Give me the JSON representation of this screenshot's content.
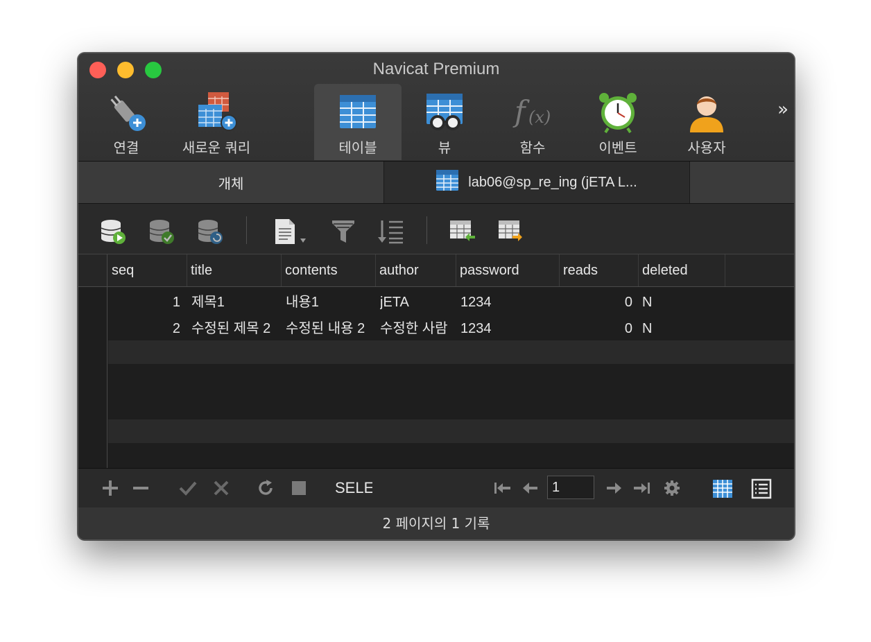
{
  "window": {
    "title": "Navicat Premium"
  },
  "toolbar": {
    "items": [
      {
        "label": "연결",
        "icon": "plug-add-icon"
      },
      {
        "label": "새로운 쿼리",
        "icon": "new-query-icon"
      },
      {
        "label": "테이블",
        "icon": "table-icon",
        "active": true
      },
      {
        "label": "뷰",
        "icon": "view-icon"
      },
      {
        "label": "함수",
        "icon": "function-icon"
      },
      {
        "label": "이벤트",
        "icon": "alarm-clock-icon"
      },
      {
        "label": "사용자",
        "icon": "user-icon"
      }
    ],
    "more": "»"
  },
  "tabs": {
    "objects": "개체",
    "table": "lab06@sp_re_ing (jETA L..."
  },
  "grid": {
    "columns": [
      "seq",
      "title",
      "contents",
      "author",
      "password",
      "reads",
      "deleted"
    ],
    "rows": [
      {
        "seq": "1",
        "title": "제목1",
        "contents": "내용1",
        "author": "jETA",
        "password": "1234",
        "reads": "0",
        "deleted": "N"
      },
      {
        "seq": "2",
        "title": "수정된 제목 2",
        "contents": "수정된 내용 2",
        "author": "수정한 사람",
        "password": "1234",
        "reads": "0",
        "deleted": "N"
      }
    ]
  },
  "editbar": {
    "sql_preview": "SELECT",
    "page": "1"
  },
  "status": {
    "text": "2 페이지의 1 기록"
  },
  "colors": {
    "accent": "#3d8fd6",
    "green_icon": "#5fb13a",
    "window_bg": "#262626"
  }
}
